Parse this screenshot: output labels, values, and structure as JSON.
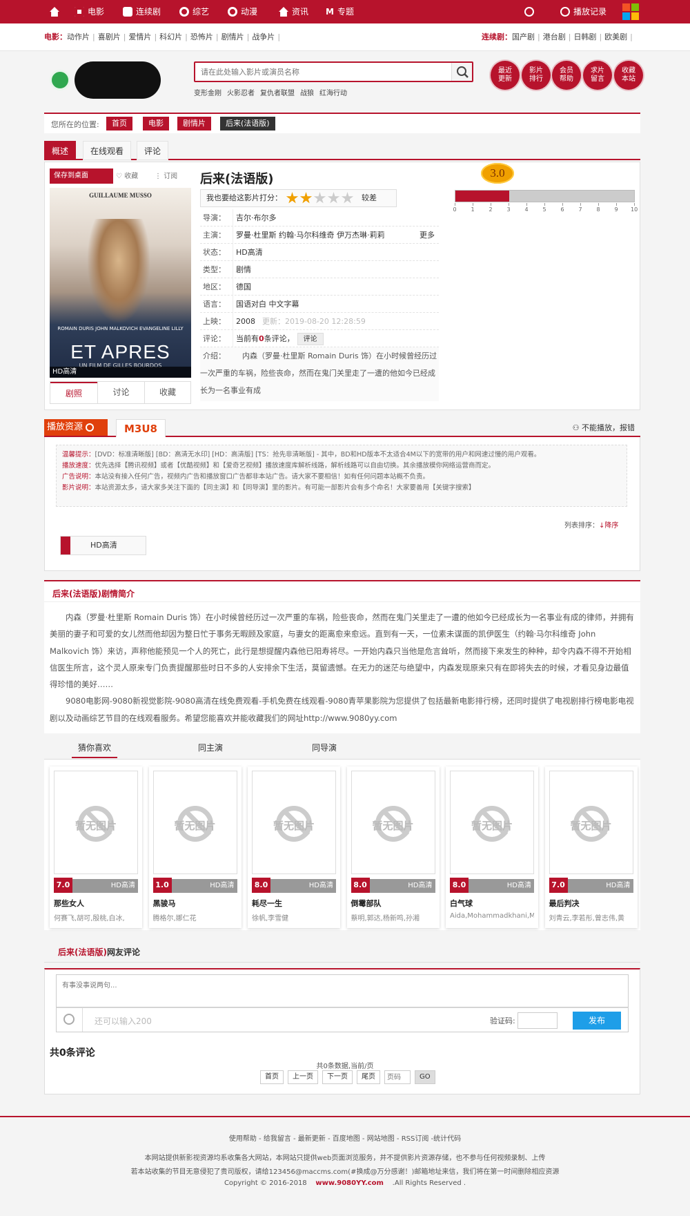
{
  "nav": {
    "items": [
      "电影",
      "连续剧",
      "综艺",
      "动漫",
      "资讯",
      "专题"
    ],
    "history": "播放记录"
  },
  "subnav": {
    "movie_label": "电影：",
    "movie_items": [
      "动作片",
      "喜剧片",
      "爱情片",
      "科幻片",
      "恐怖片",
      "剧情片",
      "战争片"
    ],
    "tv_label": "连续剧：",
    "tv_items": [
      "国产剧",
      "港台剧",
      "日韩剧",
      "欧美剧"
    ]
  },
  "search": {
    "placeholder": "请在此处输入影片或演员名称",
    "hot": [
      "变形金刚",
      "火影忍者",
      "复仇者联盟",
      "战狼",
      "红海行动"
    ]
  },
  "quick": [
    {
      "l1": "最近",
      "l2": "更新"
    },
    {
      "l1": "影片",
      "l2": "排行"
    },
    {
      "l1": "会员",
      "l2": "帮助"
    },
    {
      "l1": "求片",
      "l2": "留言"
    },
    {
      "l1": "收藏",
      "l2": "本站"
    }
  ],
  "crumb": {
    "label": "您所在的位置:",
    "items": [
      "首页",
      "电影",
      "剧情片",
      "后来(法语版)"
    ]
  },
  "tabs": [
    "概述",
    "在线观看",
    "评论"
  ],
  "detail": {
    "save": "保存到桌面",
    "fav": "收藏",
    "sub": "订阅",
    "poster_names": "ROMAIN DURIS  JOHN MALKOVICH  EVANGELINE LILLY",
    "poster_top": "GUILLAUME MUSSO",
    "poster_title": "ET APRES",
    "poster_dir": "UN FILM DE GILLES BOURDOS",
    "poster_quality": "HD高清",
    "poster_tabs": [
      "剧照",
      "讨论",
      "收藏"
    ],
    "title": "后来(法语版)",
    "rate_label": "我也要给这影片打分：",
    "rate_stars": 2,
    "rate_text": "较差",
    "rows": [
      {
        "k": "导演：",
        "v": "吉尔·布尔多"
      },
      {
        "k": "主演：",
        "v": "罗曼·杜里斯 约翰·马尔科维奇 伊万杰琳·莉莉",
        "more": "更多"
      },
      {
        "k": "状态：",
        "v": "HD高清"
      },
      {
        "k": "类型：",
        "v": "剧情"
      },
      {
        "k": "地区：",
        "v": "德国"
      },
      {
        "k": "语言：",
        "v": "国语对白 中文字幕"
      },
      {
        "k": "上映：",
        "v": "2008",
        "extra": "更新：2019-08-20 12:28:59"
      },
      {
        "k": "评论：",
        "v": "当前有",
        "count": "0",
        "tail": "条评论，",
        "btn": "评论"
      }
    ],
    "synopsis_label": "介绍：",
    "synopsis": "内森（罗曼·杜里斯 Romain Duris 饰）在小时候曾经历过一次严重的车祸，险些丧命，然而在鬼门关里走了一遭的他如今已经成长为一名事业有成"
  },
  "score": {
    "value": "3.0",
    "ratio": 0.3,
    "ticks": [
      "0",
      "1",
      "2",
      "3",
      "4",
      "5",
      "6",
      "7",
      "8",
      "9",
      "10"
    ]
  },
  "source": {
    "label": "播放资源",
    "tab": "M3U8",
    "report": "不能播放，报错",
    "tips": [
      {
        "k": "温馨提示：",
        "v": "[DVD：标准清晰版] [BD：高清无水印] [HD：高清版] [TS：抢先非清晰版] - 其中，BD和HD版本不太适合4M以下的宽带的用户和网速过慢的用户观看。"
      },
      {
        "k": "播放速度：",
        "v": "优先选择【腾讯视频】或者【优酷视频】和【爱奇艺视频】播放速度库解析线路，解析线路可以自由切换。其余播放模你网络运营商而定。"
      },
      {
        "k": "广告说明：",
        "v": "本站没有接入任何广告，视频内广告和播放窗口广告都非本站广告。请大家不要相信！如有任何问题本站概不负责。"
      },
      {
        "k": "影片说明：",
        "v": "本站资源太多，请大家多关注下面的【同主演】和【同导演】里的影片。有可能一部影片会有多个命名！大家要善用【关键字搜索】"
      }
    ],
    "sort_label": "列表排序：",
    "sort_value": "↓降序",
    "episode": "HD高清"
  },
  "plot": {
    "title": "后来(法语版)剧情简介",
    "p1": "内森（罗曼·杜里斯 Romain Duris 饰）在小时候曾经历过一次严重的车祸，险些丧命，然而在鬼门关里走了一遭的他如今已经成长为一名事业有成的律师，并拥有美丽的妻子和可爱的女儿然而他却因为整日忙于事务无暇顾及家庭，与妻女的距离愈来愈远。直到有一天，一位素未谋面的凯伊医生（约翰·马尔科维奇 John Malkovich 饰）来访，声称他能预见一个人的死亡，此行是想提醒内森他已阳寿将尽。一开始内森只当他是危言耸听，然而接下来发生的种种，却令内森不得不开始相信医生所言，这个灵人原来专门负责提醒那些时日不多的人安排余下生活，莫留遗憾。在无力的迷茫与绝望中，内森发现原来只有在即将失去的时候，才看见身边最值得珍惜的美好……",
    "p2": "9080电影网-9080新视觉影院-9080高清在线免费观看-手机免费在线观看-9080青苹果影院为您提供了包括最新电影排行榜，还同时提供了电视剧排行榜电影电视剧以及动画综艺节目的在线观看服务。希望您能喜欢并能收藏我们的网址http://www.9080yy.com"
  },
  "recs": {
    "tabs": [
      "猜你喜欢",
      "同主演",
      "同导演"
    ],
    "noimg": "暂无图片",
    "items": [
      {
        "score": "7.0",
        "q": "HD高清",
        "name": "那些女人",
        "actors": "何赛飞,胡可,殷桃,白冰,"
      },
      {
        "score": "1.0",
        "q": "HD高清",
        "name": "黑骏马",
        "actors": "腾格尔,娜仁花"
      },
      {
        "score": "8.0",
        "q": "HD高清",
        "name": "耗尽一生",
        "actors": "徐帆,李雪健"
      },
      {
        "score": "8.0",
        "q": "HD高清",
        "name": "倒霉部队",
        "actors": "蔡明,郭达,杨新鸣,孙湘"
      },
      {
        "score": "8.0",
        "q": "HD高清",
        "name": "白气球",
        "actors": "Aida,Mohammadkhani,M"
      },
      {
        "score": "7.0",
        "q": "HD高清",
        "name": "最后判决",
        "actors": "刘青云,李若彤,曾志伟,黄"
      }
    ]
  },
  "comments": {
    "title_red": "后来(法语版)",
    "title_tail": "网友评论",
    "placeholder": "有事没事说两句...",
    "counter": "还可以输入200",
    "verify": "验证码:",
    "submit": "发布",
    "total": "共0条评论",
    "pageinfo": "共0条数据,当前/页",
    "pager": [
      "首页",
      "上一页",
      "下一页",
      "尾页"
    ],
    "page_ph": "页码",
    "go": "GO"
  },
  "footer": {
    "links": "使用帮助  -  给我留言  -  最新更新  -  百度地图  -  网站地图  -  RSS订阅  -统计代码",
    "l1": "本网站提供新影视资源均系收集各大网站，本网站只提供web页面浏览服务，并不提供影片资源存储，也不参与任何视频录制、上传",
    "l2": "若本站收集的节目无意侵犯了贵司版权，请给123456@maccms.com(#换成@万分感谢！)邮箱地址来信，我们将在第一时间删除相应资源",
    "copy1": "Copyright © 2016-2018",
    "site": "www.9080YY.com",
    "copy2": ".All Rights Reserved ."
  },
  "colors": {
    "brand": "#b7132c",
    "orange": "#e0400c",
    "blue": "#1e9ee8"
  }
}
